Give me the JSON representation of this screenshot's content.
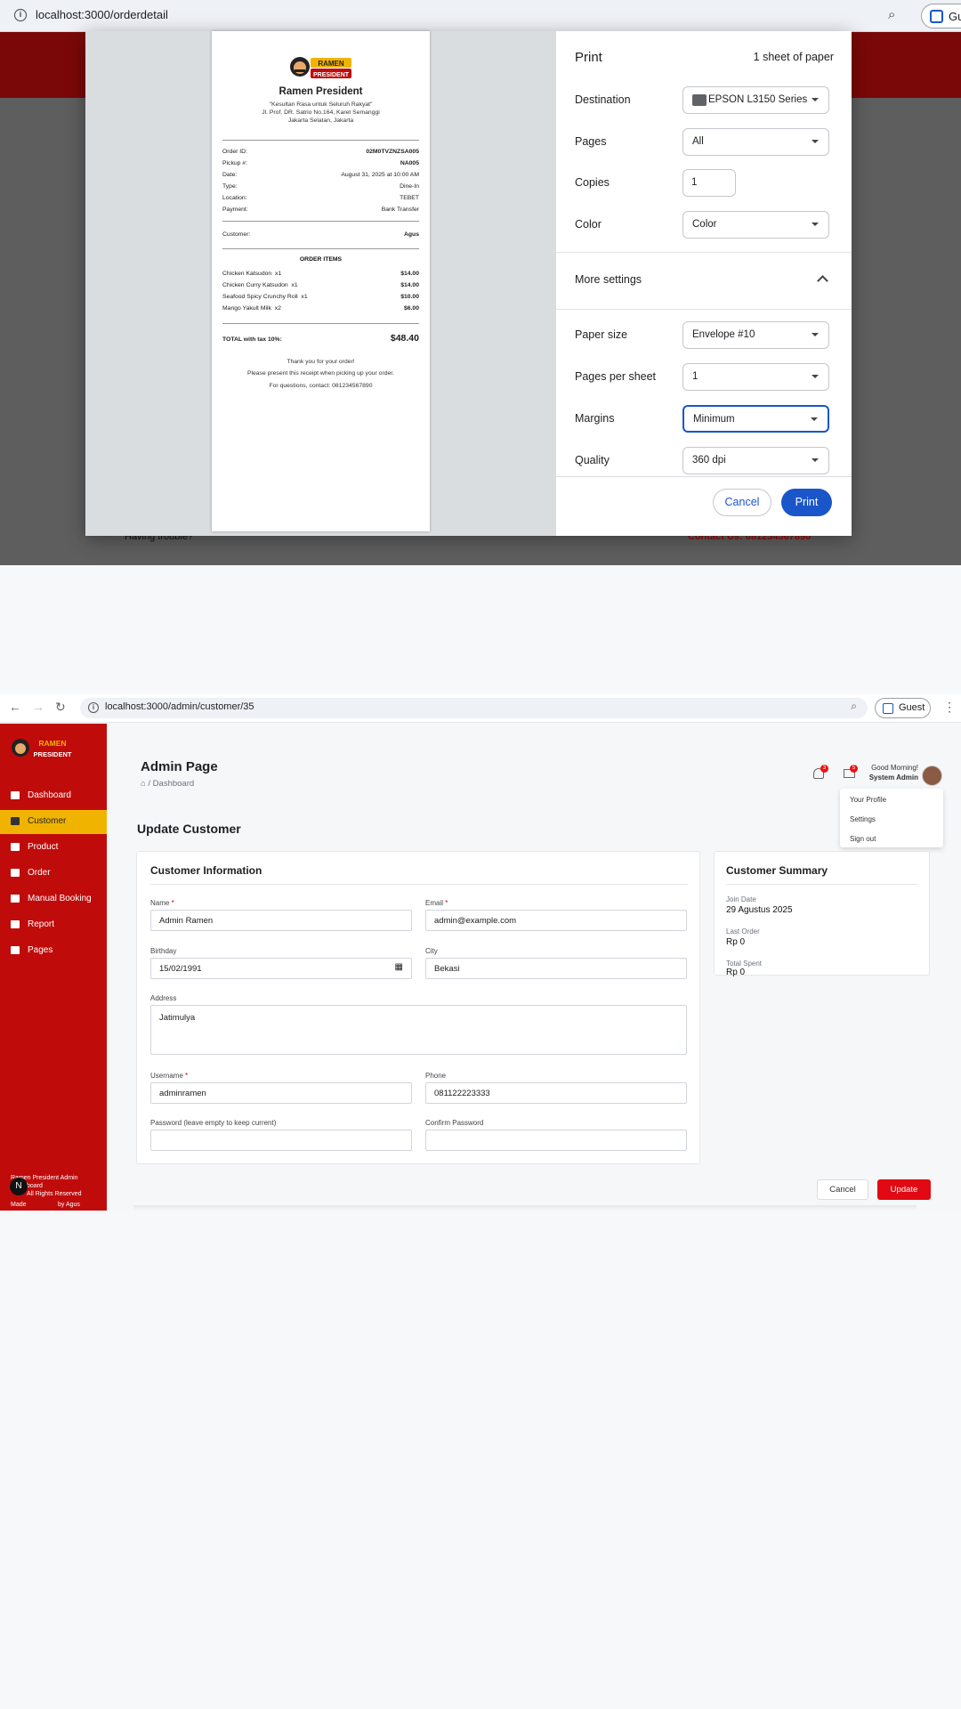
{
  "top": {
    "url": "localhost:3000/orderdetail",
    "guest_label": "Gu",
    "bg_having_trouble": "Having trouble?",
    "bg_contact": "Contact Us: 081234567890",
    "receipt": {
      "logo_text": "RAMEN PRESIDENT",
      "name": "Ramen President",
      "tagline": "\"Kesultan Rasa untuk Seluruh Rakyat\"",
      "address1": "Jl. Prof. DR. Satrio No.164, Karet Semanggi",
      "address2": "Jakarta Selatan, Jakarta",
      "info": [
        {
          "label": "Order ID:",
          "value": "02M0TVZNZSA005"
        },
        {
          "label": "Pickup #:",
          "value": "NA005"
        },
        {
          "label": "Date:",
          "value": "August 31, 2025 at 10:00 AM"
        },
        {
          "label": "Type:",
          "value": "Dine-In"
        },
        {
          "label": "Location:",
          "value": "TEBET"
        },
        {
          "label": "Payment:",
          "value": "Bank Transfer"
        }
      ],
      "customer_label": "Customer:",
      "customer_value": "Agus",
      "items_title": "ORDER ITEMS",
      "items": [
        {
          "name": "Chicken Katsudon",
          "qty": "x1",
          "price": "$14.00"
        },
        {
          "name": "Chicken Curry Katsudon",
          "qty": "x1",
          "price": "$14.00"
        },
        {
          "name": "Seafood Spicy Crunchy Roll",
          "qty": "x1",
          "price": "$10.00"
        },
        {
          "name": "Mango Yakult Milk",
          "qty": "x2",
          "price": "$6.00"
        }
      ],
      "total_label": "TOTAL with tax 10%:",
      "total_value": "$48.40",
      "thanks": "Thank you for your order!",
      "present": "Please present this receipt when picking up your order.",
      "questions": "For questions, contact: 081234567890"
    },
    "print": {
      "title": "Print",
      "sheets": "1 sheet of paper",
      "destination_label": "Destination",
      "destination_value": "EPSON L3150 Series",
      "pages_label": "Pages",
      "pages_value": "All",
      "copies_label": "Copies",
      "copies_value": "1",
      "color_label": "Color",
      "color_value": "Color",
      "more_settings": "More settings",
      "paper_size_label": "Paper size",
      "paper_size_value": "Envelope #10",
      "pps_label": "Pages per sheet",
      "pps_value": "1",
      "margins_label": "Margins",
      "margins_value": "Minimum",
      "quality_label": "Quality",
      "quality_value": "360 dpi",
      "cancel": "Cancel",
      "print": "Print"
    }
  },
  "bottom": {
    "url": "localhost:3000/admin/customer/35",
    "guest_label": "Guest",
    "sidebar": {
      "logo_text": "RAMEN PRESIDENT",
      "items": [
        {
          "label": "Dashboard"
        },
        {
          "label": "Customer"
        },
        {
          "label": "Product"
        },
        {
          "label": "Order"
        },
        {
          "label": "Manual Booking"
        },
        {
          "label": "Report"
        },
        {
          "label": "Pages"
        }
      ],
      "footer1": "Ramen President Admin",
      "footer2": "board",
      "footer3": "All Rights Reserved",
      "footer4": "Made",
      "footer5": "by Agus",
      "n_badge": "N"
    },
    "header": {
      "title": "Admin Page",
      "breadcrumb": "Dashboard",
      "bell_count": "3",
      "mail_count": "5",
      "greeting": "Good Morning!",
      "user": "System Admin"
    },
    "menu": {
      "profile": "Your Profile",
      "settings": "Settings",
      "signout": "Sign out"
    },
    "page_title": "Update Customer",
    "form": {
      "title": "Customer Information",
      "name_label": "Name",
      "name_value": "Admin Ramen",
      "email_label": "Email",
      "email_value": "admin@example.com",
      "birthday_label": "Birthday",
      "birthday_value": "15/02/1991",
      "city_label": "City",
      "city_value": "Bekasi",
      "address_label": "Address",
      "address_value": "Jatimulya",
      "username_label": "Username",
      "username_value": "adminramen",
      "phone_label": "Phone",
      "phone_value": "081122223333",
      "password_label": "Password (leave empty to keep current)",
      "password_value": "",
      "confirm_label": "Confirm Password",
      "confirm_value": "",
      "required_mark": "*"
    },
    "summary": {
      "title": "Customer Summary",
      "join_label": "Join Date",
      "join_value": "29 Agustus 2025",
      "last_label": "Last Order",
      "last_value": "Rp 0",
      "total_label": "Total Spent",
      "total_value": "Rp 0"
    },
    "cancel": "Cancel",
    "update": "Update"
  }
}
